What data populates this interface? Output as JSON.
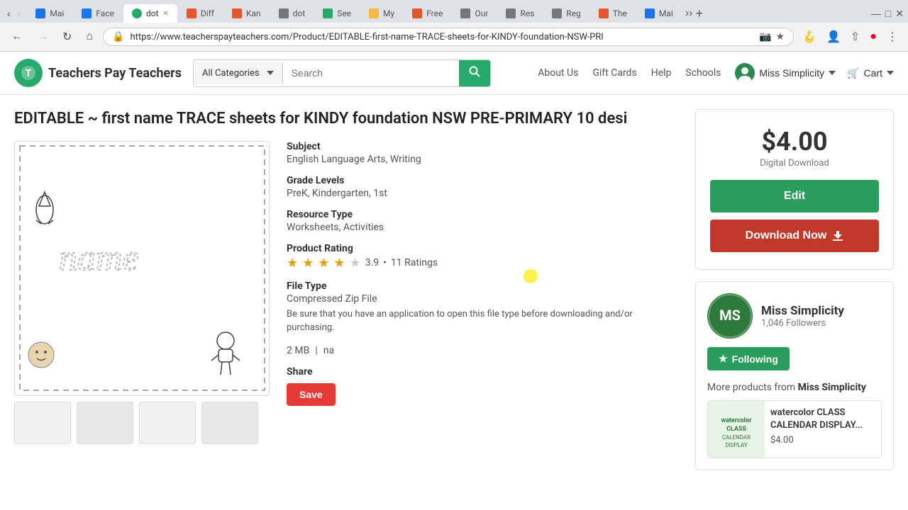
{
  "browser": {
    "tabs": [
      {
        "label": "Mai",
        "icon_color": "#1a73e8",
        "active": false
      },
      {
        "label": "Face",
        "icon_color": "#1877f2",
        "active": false
      },
      {
        "label": "dot",
        "icon_color": "#27a96c",
        "active": true
      },
      {
        "label": "Diff",
        "icon_color": "#e4572e",
        "active": false
      },
      {
        "label": "Kan",
        "icon_color": "#e4572e",
        "active": false
      },
      {
        "label": "dot",
        "icon_color": "#555",
        "active": false
      },
      {
        "label": "See",
        "icon_color": "#27a96c",
        "active": false
      },
      {
        "label": "My",
        "icon_color": "#f4b942",
        "active": false
      },
      {
        "label": "Free",
        "icon_color": "#e4572e",
        "active": false
      },
      {
        "label": "Our",
        "icon_color": "#555",
        "active": false
      },
      {
        "label": "Res",
        "icon_color": "#555",
        "active": false
      },
      {
        "label": "Reg",
        "icon_color": "#555",
        "active": false
      },
      {
        "label": "The",
        "icon_color": "#e4572e",
        "active": false
      },
      {
        "label": "Mai",
        "icon_color": "#1a73e8",
        "active": false
      }
    ],
    "url": "https://www.teacherspayteachers.com/Product/EDITABLE-first-name-TRACE-sheets-for-KINDY-foundation-NSW-PRI"
  },
  "header": {
    "logo_text": "Teachers Pay Teachers",
    "search_placeholder": "Search",
    "category_label": "All Categories",
    "nav_links": [
      "About Us",
      "Gift Cards",
      "Help",
      "Schools"
    ],
    "user_name": "Miss Simplicity",
    "cart_label": "Cart"
  },
  "product": {
    "title": "EDITABLE ~ first name TRACE sheets for KINDY foundation NSW PRE-PRIMARY 10 desi",
    "subject_label": "Subject",
    "subject_value": "English Language Arts, Writing",
    "grade_label": "Grade Levels",
    "grade_value": "PreK, Kindergarten, 1st",
    "resource_label": "Resource Type",
    "resource_value": "Worksheets, Activities",
    "rating_label": "Product Rating",
    "rating_value": 3.9,
    "rating_count": "11 Ratings",
    "file_type_label": "File Type",
    "file_type_value": "Compressed Zip File",
    "file_description": "Be sure that you have an application to open this file type before downloading and/or purchasing.",
    "file_size": "2 MB",
    "file_na": "na",
    "share_label": "Share",
    "save_btn": "Save"
  },
  "sidebar": {
    "price": "$4.00",
    "digital_label": "Digital Download",
    "edit_btn": "Edit",
    "download_btn": "Download Now",
    "seller_name": "Miss Simplicity",
    "seller_followers": "1,046 Followers",
    "following_btn": "Following",
    "more_products_label": "More products from",
    "more_products_seller": "Miss Simplicity",
    "related_product_title": "watercolor CLASS CALENDAR DISPLAY...",
    "related_product_price": "$4.00"
  }
}
